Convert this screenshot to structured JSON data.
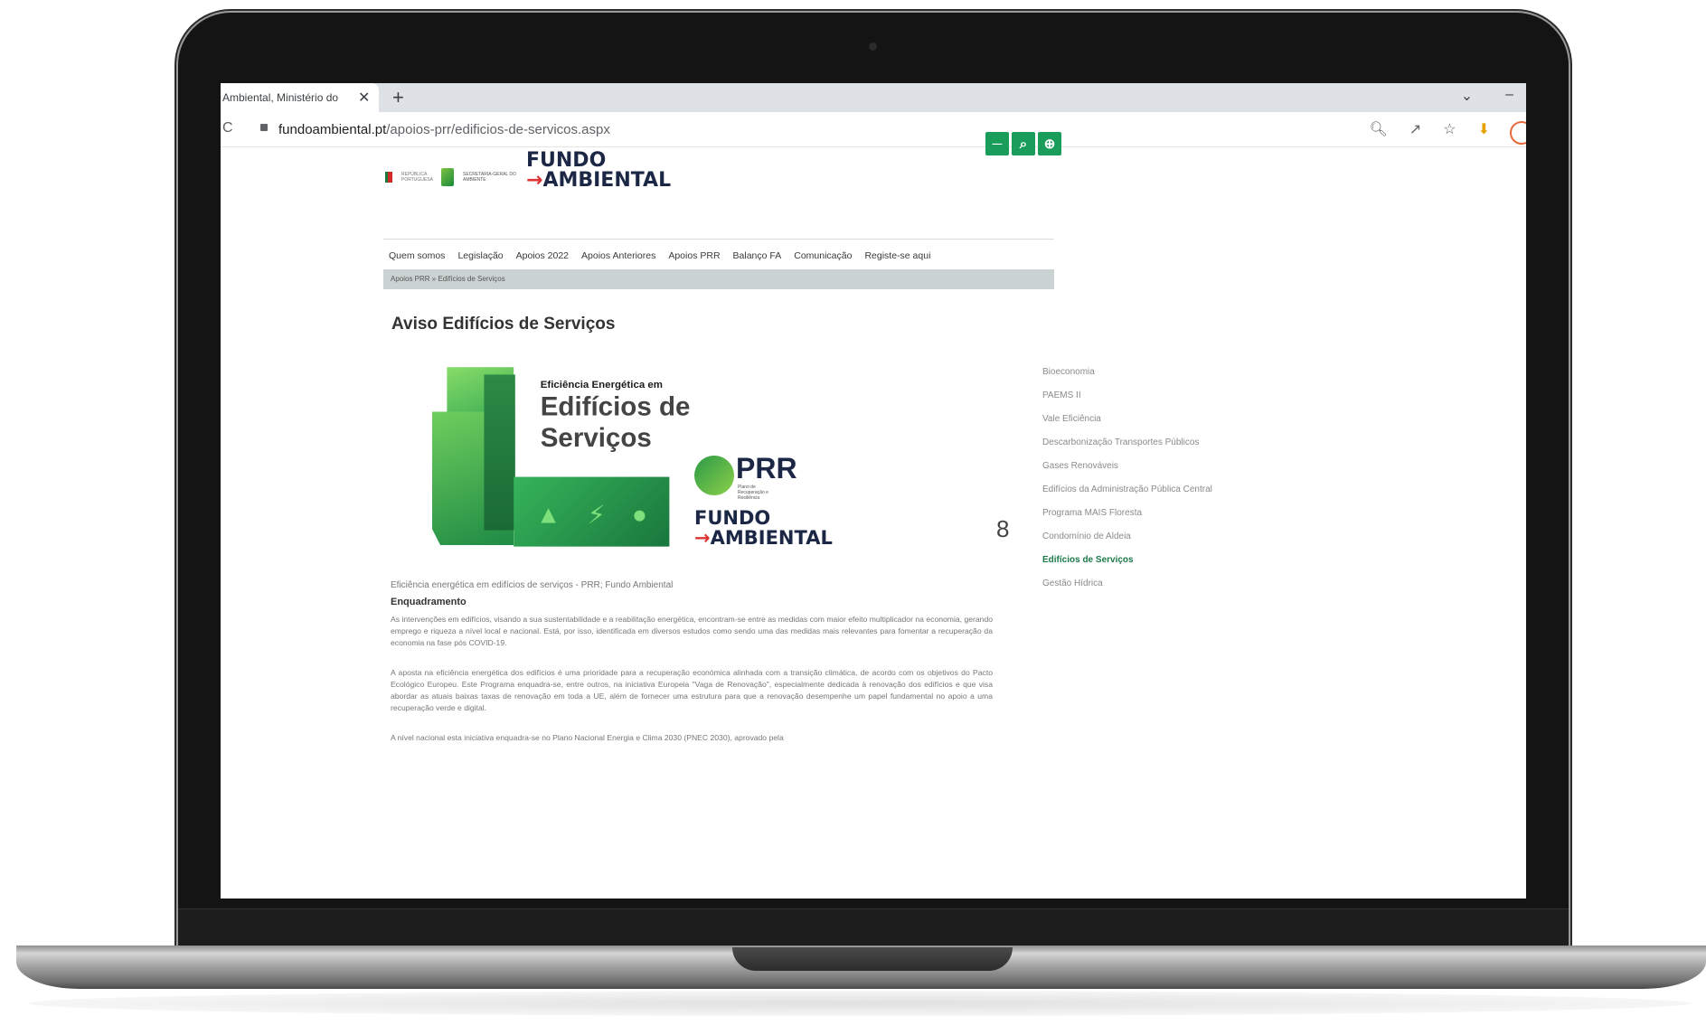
{
  "browser": {
    "tab_title": "Ambiental, Ministério do",
    "tab_close": "✕",
    "new_tab": "+",
    "url_domain": "fundoambiental.pt",
    "url_path": "/apoios-prr/edificios-de-servicos.aspx",
    "window_controls": [
      "⌄",
      "–"
    ]
  },
  "header": {
    "gov_text": "REPÚBLICA PORTUGUESA",
    "sg_text": "SECRETARIA-GERAL DO AMBIENTE",
    "logo_line1": "FUNDO",
    "logo_line2": "AMBIENTAL",
    "utility_icons": [
      "key-icon",
      "search-icon",
      "globe-icon"
    ]
  },
  "nav": {
    "items": [
      "Quem somos",
      "Legislação",
      "Apoios 2022",
      "Apoios Anteriores",
      "Apoios PRR",
      "Balanço FA",
      "Comunicação",
      "Registe-se aqui"
    ]
  },
  "breadcrumb": "Apoios PRR » Edifícios de Serviços",
  "main": {
    "title": "Aviso Edifícios de Serviços",
    "hero": {
      "kicker": "Eficiência Energética em",
      "title_line1": "Edifícios de",
      "title_line2": "Serviços",
      "prr": "PRR",
      "prr_sub": "Plano de Recuperação e Resiliência",
      "fa_line1": "FUNDO",
      "fa_line2": "AMBIENTAL"
    },
    "page_number": "8",
    "caption": "Eficiência energética em edifícios de serviços - PRR; Fundo Ambiental",
    "section_heading": "Enquadramento",
    "paragraphs": [
      "As intervenções em edifícios, visando a sua sustentabilidade e a reabilitação energética, encontram-se entre as medidas com maior efeito multiplicador na economia, gerando emprego e riqueza a nível local e nacional. Está, por isso, identificada em diversos estudos como sendo uma das medidas mais relevantes para fomentar a recuperação da economia na fase pós COVID-19.",
      "A aposta na eficiência energética dos edifícios é uma prioridade para a recuperação económica alinhada com a transição climática, de acordo com os objetivos do Pacto Ecológico Europeu. Este Programa enquadra-se, entre outros, na iniciativa Europeia \"Vaga de Renovação\", especialmente dedicada à renovação dos edifícios e que visa abordar as atuais baixas taxas de renovação em toda a UE, além de fornecer uma estrutura para que a renovação desempenhe um papel fundamental no apoio a uma recuperação verde e digital.",
      "A nível nacional esta iniciativa enquadra-se no Plano Nacional Energia e Clima 2030 (PNEC 2030), aprovado pela"
    ]
  },
  "sidebar": {
    "items": [
      {
        "label": "Bioeconomia",
        "active": false
      },
      {
        "label": "PAEMS II",
        "active": false
      },
      {
        "label": "Vale Eficiência",
        "active": false
      },
      {
        "label": "Descarbonização Transportes Públicos",
        "active": false
      },
      {
        "label": "Gases Renováveis",
        "active": false
      },
      {
        "label": "Edifícios da Administração Pública Central",
        "active": false
      },
      {
        "label": "Programa MAIS Floresta",
        "active": false
      },
      {
        "label": "Condomínio de Aldeia",
        "active": false
      },
      {
        "label": "Edifícios de Serviços",
        "active": true
      },
      {
        "label": "Gestão Hídrica",
        "active": false
      }
    ]
  }
}
